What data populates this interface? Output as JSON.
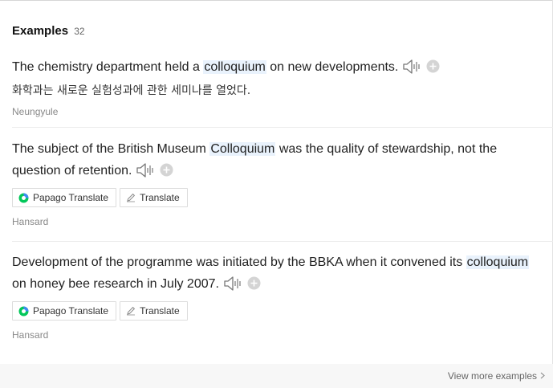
{
  "header": {
    "title": "Examples",
    "count": "32"
  },
  "examples": [
    {
      "before": "The chemistry department held a ",
      "highlight": "colloquium",
      "after": " on new developments.",
      "translation": "화학과는 새로운 실험성과에 관한 세미나를 열었다.",
      "source": "Neungyule"
    },
    {
      "before": "The subject of the British Museum ",
      "highlight": "Colloquium",
      "after": " was the quality of stewardship, not the question of retention.",
      "source": "Hansard"
    },
    {
      "before": "Development of the programme was initiated by the BBKA when it convened its ",
      "highlight": "colloquium",
      "after": " on honey bee research in July 2007.",
      "source": "Hansard"
    }
  ],
  "buttons": {
    "papago": "Papago Translate",
    "translate": "Translate"
  },
  "footer": {
    "more": "View more examples"
  },
  "icons": [
    "speaker-icon",
    "plus-icon",
    "papago-icon",
    "pencil-icon",
    "chevron-right-icon"
  ],
  "colors": {
    "highlight": "#e9f2fc",
    "papago_green": "#03c75a",
    "papago_blue": "#3d8bf2"
  }
}
